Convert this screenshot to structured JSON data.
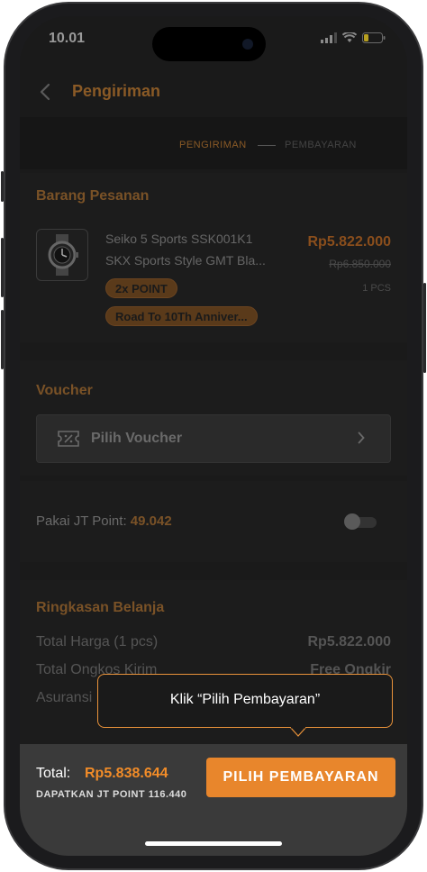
{
  "status": {
    "time": "10.01"
  },
  "appbar": {
    "title": "Pengiriman"
  },
  "steps": {
    "active": "PENGIRIMAN",
    "next": "PEMBAYARAN"
  },
  "order": {
    "section_title": "Barang Pesanan",
    "product_line1": "Seiko 5 Sports SSK001K1",
    "product_line2": "SKX Sports Style GMT Bla...",
    "price": "Rp5.822.000",
    "old_price": "Rp6.850.000",
    "qty": "1 PCS",
    "badge_point": "2x POINT",
    "badge_promo": "Road To 10Th Anniver..."
  },
  "voucher": {
    "section_title": "Voucher",
    "label": "Pilih Voucher"
  },
  "jt_point": {
    "label": "Pakai JT Point:",
    "value": "49.042"
  },
  "summary": {
    "section_title": "Ringkasan Belanja",
    "rows": [
      {
        "label": "Total Harga (1 pcs)",
        "value": "Rp5.822.000"
      },
      {
        "label": "Total Ongkos Kirim",
        "value": "Free Ongkir"
      },
      {
        "label": "Asuransi",
        "value": ""
      }
    ]
  },
  "tooltip": {
    "text": "Klik “Pilih Pembayaran”"
  },
  "footer": {
    "total_label": "Total:",
    "total_value": "Rp5.838.644",
    "points_earn": "DAPATKAN JT POINT 116.440",
    "pay_button": "PILIH PEMBAYARAN"
  },
  "colors": {
    "accent": "#e8862c",
    "tooltip_border": "#e8923a"
  }
}
